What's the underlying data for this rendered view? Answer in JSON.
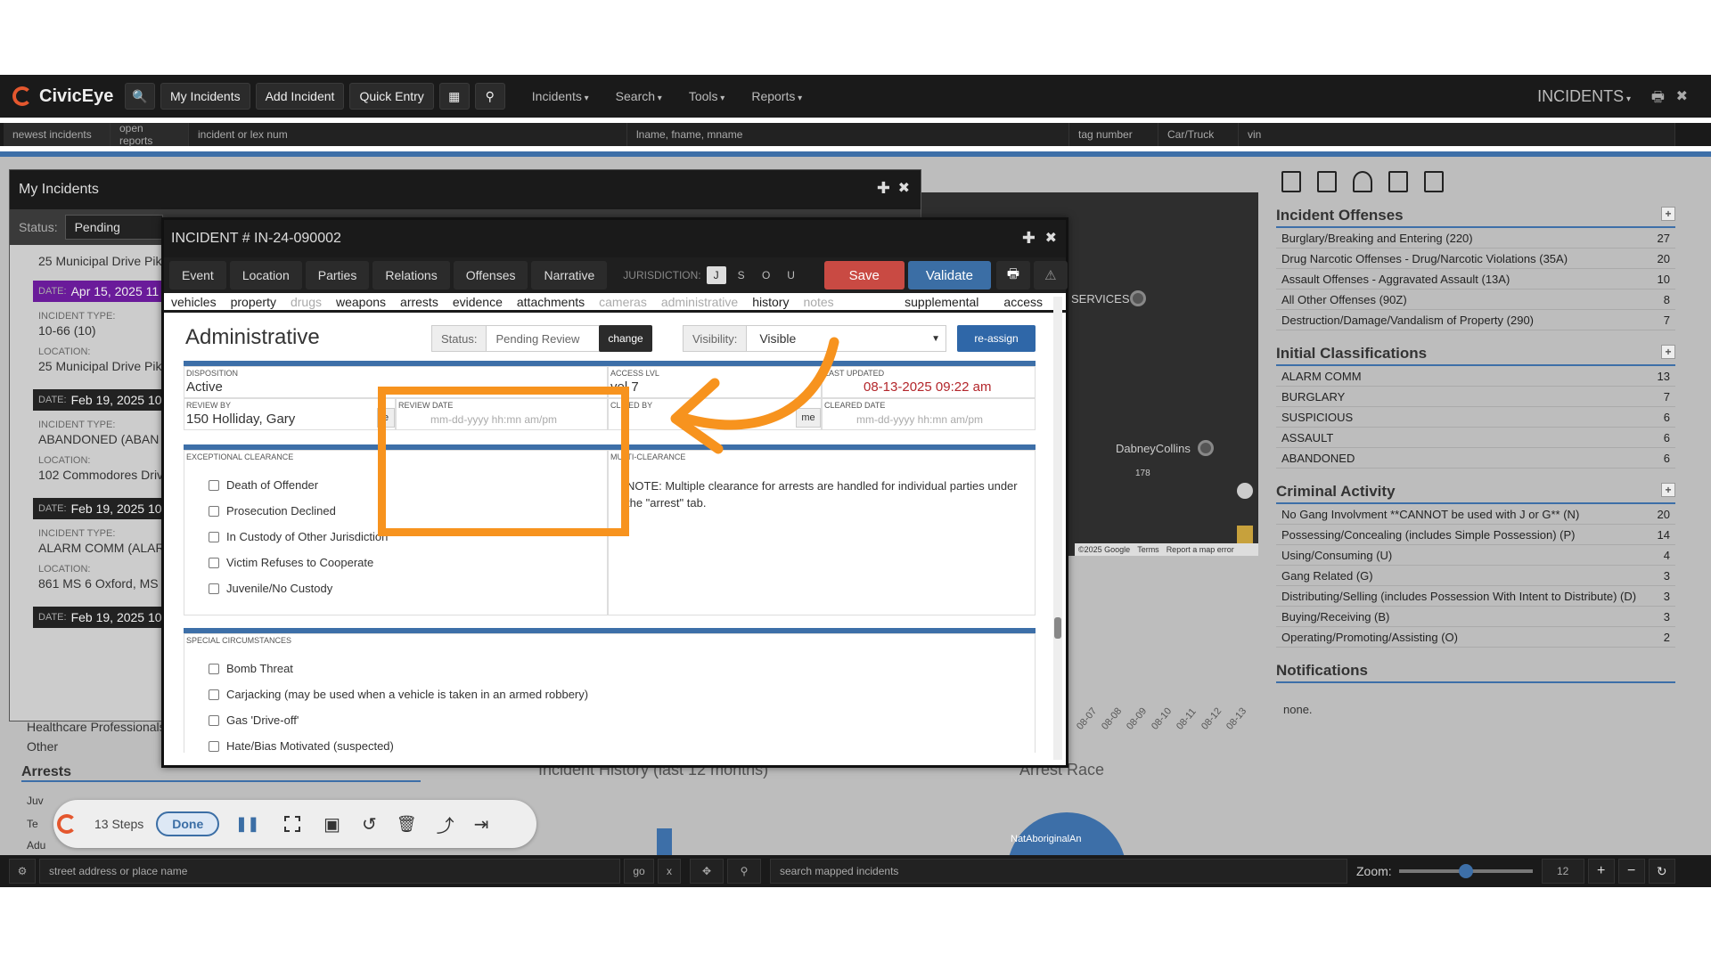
{
  "nav": {
    "logo": "CivicEye",
    "buttons": [
      "My Incidents",
      "Add Incident",
      "Quick Entry"
    ],
    "menus": [
      "Incidents",
      "Search",
      "Tools",
      "Reports"
    ],
    "section_title": "INCIDENTS"
  },
  "quickbar": {
    "newest": "newest incidents",
    "open": "open reports",
    "incident_placeholder": "incident or lex num",
    "name_placeholder": "lname, fname, mname",
    "tag_placeholder": "tag number",
    "vehicle_type": "Car/Truck",
    "vin_placeholder": "vin"
  },
  "my_incidents": {
    "title": "My Incidents",
    "status_label": "Status:",
    "status_value": "Pending",
    "first_location": "25 Municipal Drive Pik",
    "items": [
      {
        "date": "Apr 15, 2025 11",
        "type": "10-66 (10)",
        "location": "25 Municipal Drive Pik",
        "highlight": true
      },
      {
        "date": "Feb 19, 2025 10",
        "type": "ABANDONED (ABAN",
        "location": "102 Commodores Driv",
        "highlight": false
      },
      {
        "date": "Feb 19, 2025 10",
        "type": "ALARM COMM (ALAR",
        "location": "861 MS 6 Oxford, MS",
        "highlight": false
      },
      {
        "date": "Feb 19, 2025 10",
        "type": "",
        "location": "",
        "highlight": false
      }
    ],
    "date_key": "DATE:",
    "type_key": "INCIDENT TYPE:",
    "location_key": "LOCATION:"
  },
  "lower_left": {
    "healthcare": "Healthcare Professionals",
    "other": "Other",
    "arrests": "Arrests",
    "juv": "Juv",
    "te": "Te",
    "adu": "Adu"
  },
  "background": {
    "incident_history": "Incident History (last 12 months)",
    "arrest_race": "Arrest Race",
    "pie_label": "NatAboriginalAn",
    "ticks": [
      "08-07",
      "08-08",
      "08-09",
      "08-10",
      "08-11",
      "08-12",
      "08-13"
    ]
  },
  "map": {
    "labels": [
      "SERVICES",
      "DabneyCollins",
      "178"
    ],
    "footer": [
      "©2025 Google",
      "Terms",
      "Report a map error"
    ]
  },
  "right_panel": {
    "sections": [
      {
        "title": "Incident Offenses",
        "rows": [
          {
            "label": "Burglary/Breaking and Entering (220)",
            "count": "27"
          },
          {
            "label": "Drug Narcotic Offenses - Drug/Narcotic Violations (35A)",
            "count": "20"
          },
          {
            "label": "Assault Offenses - Aggravated Assault (13A)",
            "count": "10"
          },
          {
            "label": "All Other Offenses (90Z)",
            "count": "8"
          },
          {
            "label": "Destruction/Damage/Vandalism of Property (290)",
            "count": "7"
          }
        ]
      },
      {
        "title": "Initial Classifications",
        "rows": [
          {
            "label": "ALARM COMM",
            "count": "13"
          },
          {
            "label": "BURGLARY",
            "count": "7"
          },
          {
            "label": "SUSPICIOUS",
            "count": "6"
          },
          {
            "label": "ASSAULT",
            "count": "6"
          },
          {
            "label": "ABANDONED",
            "count": "6"
          }
        ]
      },
      {
        "title": "Criminal Activity",
        "rows": [
          {
            "label": "No Gang Involvment **CANNOT be used with J or G** (N)",
            "count": "20"
          },
          {
            "label": "Possessing/Concealing (includes Simple Possession) (P)",
            "count": "14"
          },
          {
            "label": "Using/Consuming (U)",
            "count": "4"
          },
          {
            "label": "Gang Related (G)",
            "count": "3"
          },
          {
            "label": "Distributing/Selling (includes Possession With Intent to Distribute) (D)",
            "count": "3"
          },
          {
            "label": "Buying/Receiving (B)",
            "count": "3"
          },
          {
            "label": "Operating/Promoting/Assisting (O)",
            "count": "2"
          }
        ]
      }
    ],
    "notifications_title": "Notifications",
    "notifications_value": "none."
  },
  "dialog": {
    "title": "INCIDENT # IN-24-090002",
    "tabs": [
      "Event",
      "Location",
      "Parties",
      "Relations",
      "Offenses",
      "Narrative"
    ],
    "jurisdiction_label": "JURISDICTION:",
    "jurisdiction_options": [
      "J",
      "S",
      "O",
      "U"
    ],
    "save": "Save",
    "validate": "Validate",
    "subtabs": [
      {
        "label": "vehicles",
        "dim": false
      },
      {
        "label": "property",
        "dim": false
      },
      {
        "label": "drugs",
        "dim": true
      },
      {
        "label": "weapons",
        "dim": false
      },
      {
        "label": "arrests",
        "dim": false
      },
      {
        "label": "evidence",
        "dim": false
      },
      {
        "label": "attachments",
        "dim": false
      },
      {
        "label": "cameras",
        "dim": true
      },
      {
        "label": "administrative",
        "dim": true
      },
      {
        "label": "history",
        "dim": false
      },
      {
        "label": "notes",
        "dim": true
      }
    ],
    "subtab_right": [
      "supplemental",
      "access"
    ],
    "section_title": "Administrative",
    "status_label": "Status:",
    "status_value": "Pending Review",
    "change": "change",
    "visibility_label": "Visibility:",
    "visibility_value": "Visible",
    "reassign": "re-assign",
    "disposition_label": "DISPOSITION",
    "disposition_value": "Active",
    "access_label": "ACCESS LVL",
    "access_value": "vel 7",
    "last_updated_label": "LAST UPDATED",
    "last_updated_value": "08-13-2025 09:22 am",
    "review_by_label": "REVIEW BY",
    "review_by_value": "150 Holliday, Gary",
    "me_short": "e",
    "review_date_label": "REVIEW DATE",
    "review_date_placeholder": "mm-dd-yyyy hh:mn am/pm",
    "cleared_by_label": "CL RED BY",
    "me": "me",
    "cleared_date_label": "CLEARED DATE",
    "cleared_date_placeholder": "mm-dd-yyyy hh:mn am/pm",
    "exceptional_label": "EXCEPTIONAL CLEARANCE",
    "exceptional_items": [
      "Death of Offender",
      "Prosecution Declined",
      "In Custody of Other Jurisdiction",
      "Victim Refuses to Cooperate",
      "Juvenile/No Custody"
    ],
    "multi_label": "MULTI-CLEARANCE",
    "multi_note": "NOTE: Multiple clearance for arrests are handled for individual parties under the \"arrest\" tab.",
    "special_label": "SPECIAL CIRCUMSTANCES",
    "special_items": [
      "Bomb Threat",
      "Carjacking (may be used when a vehicle is taken in an armed robbery)",
      "Gas 'Drive-off'",
      "Hate/Bias Motivated (suspected)"
    ]
  },
  "playback": {
    "steps": "13 Steps",
    "done": "Done"
  },
  "bottom_bar": {
    "address_placeholder": "street address or place name",
    "go": "go",
    "x": "x",
    "search_placeholder": "search mapped incidents",
    "zoom_label": "Zoom:",
    "zoom_value": "12",
    "zoom_level": 0.5
  },
  "colors": {
    "accent": "#3d6fa8",
    "highlight": "#f7931e",
    "save": "#c94a43",
    "validate": "#3b6ea5",
    "date_purple": "#6a1b9a"
  }
}
